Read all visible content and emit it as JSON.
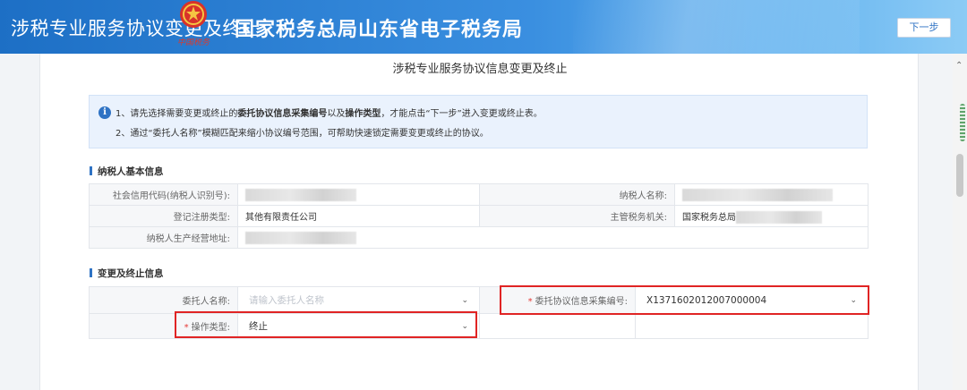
{
  "header": {
    "page_name": "涉税专业服务协议变更及终止",
    "emblem_caption": "中国税务",
    "bureau": "国家税务总局山东省电子税务局",
    "next_button": "下一步"
  },
  "page_title": "涉税专业服务协议信息变更及终止",
  "notice": {
    "line1_a": "1、请先选择需要变更或终止的",
    "line1_b": "委托协议信息采集编号",
    "line1_c": "以及",
    "line1_d": "操作类型",
    "line1_e": "，才能点击“下一步”进入变更或终止表。",
    "line2": "2、通过“委托人名称”模糊匹配来缩小协议编号范围，可帮助快速锁定需要变更或终止的协议。"
  },
  "taxpayer_section": {
    "title": "纳税人基本信息",
    "labels": {
      "credit_code": "社会信用代码(纳税人识别号):",
      "taxpayer_name": "纳税人名称:",
      "reg_type": "登记注册类型:",
      "tax_office": "主管税务机关:",
      "address": "纳税人生产经营地址:"
    },
    "values": {
      "reg_type": "其他有限责任公司",
      "tax_office_prefix": "国家税务总局"
    }
  },
  "change_section": {
    "title": "变更及终止信息",
    "labels": {
      "principal_name": "委托人名称:",
      "agreement_no": "委托协议信息采集编号:",
      "operation_type": "操作类型:"
    },
    "principal_placeholder": "请输入委托人名称",
    "agreement_no_value": "X1371602012007000004",
    "operation_type_value": "终止"
  },
  "icons": {
    "info": "info-icon",
    "dropdown": "chevron-down-icon",
    "emblem": "national-emblem-icon"
  },
  "colors": {
    "header_start": "#1d6fc5",
    "accent": "#2f73c4",
    "highlight": "#e02424",
    "required": "#e53935"
  }
}
